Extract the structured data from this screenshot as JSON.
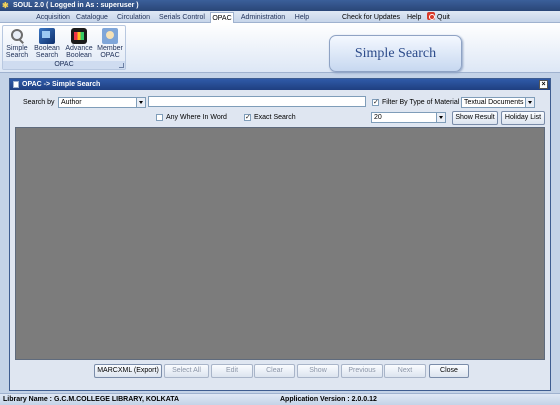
{
  "window": {
    "title": "SOUL 2.0  ( Logged in As : superuser )"
  },
  "menu": {
    "tabs": [
      {
        "label": "Acquisition"
      },
      {
        "label": "Catalogue"
      },
      {
        "label": "Circulation"
      },
      {
        "label": "Serials Control"
      },
      {
        "label": "OPAC",
        "active": true
      },
      {
        "label": "Administration"
      },
      {
        "label": "Help"
      }
    ],
    "right": {
      "check_updates": "Check for Updates",
      "help": "Help",
      "quit": "Quit"
    }
  },
  "ribbon": {
    "group_label": "OPAC",
    "buttons": [
      {
        "line1": "Simple",
        "line2": "Search",
        "icon": "magnifier-icon"
      },
      {
        "line1": "Boolean",
        "line2": "Search",
        "icon": "boolean-search-icon"
      },
      {
        "line1": "Advance",
        "line2": "Boolean",
        "icon": "advance-boolean-icon"
      },
      {
        "line1": "Member",
        "line2": "OPAC",
        "icon": "member-icon"
      }
    ],
    "banner": "Simple Search"
  },
  "opac_window": {
    "title": "OPAC -> Simple Search",
    "search_by_label": "Search by",
    "search_by_value": "Author",
    "search_text": "",
    "filter_label": "Filter By Type of Material",
    "filter_checked": true,
    "material_value": "Textual Documents",
    "any_where_label": "Any Where In Word",
    "any_where_checked": false,
    "exact_label": "Exact Search",
    "exact_checked": true,
    "results_count": "20",
    "show_result": "Show Result",
    "holiday_list": "Holiday List",
    "bottom_buttons": {
      "marcxml": "MARCXML (Export)",
      "select_all": "Select All",
      "edit": "Edit",
      "clear": "Clear",
      "show": "Show",
      "previous": "Previous",
      "next": "Next",
      "close": "Close"
    }
  },
  "status": {
    "library": "Library Name : G.C.M.COLLEGE LIBRARY, KOLKATA",
    "version": "Application Version : 2.0.0.12"
  },
  "colors": {
    "title_bar": "#2a4677",
    "grid_background": "#7c7c7c",
    "banner_text": "#2b4a8a"
  }
}
